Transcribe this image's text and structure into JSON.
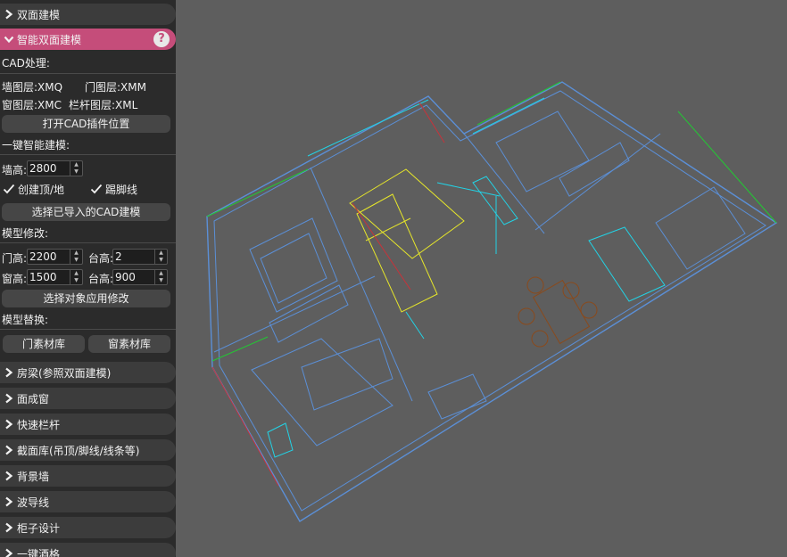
{
  "panel": {
    "sec_double_face": "双面建模",
    "sec_smart": "智能双面建模",
    "help_glyph": "?",
    "cad_process": "CAD处理:",
    "wall_layer": "墙图层:XMQ",
    "door_layer": "门图层:XMM",
    "window_layer": "窗图层:XMC",
    "rail_layer": "栏杆图层:XML",
    "open_cad_btn": "打开CAD插件位置",
    "one_click": "一键智能建模:",
    "wall_height_label": "墙高:",
    "wall_height": "2800",
    "create_top_bottom": "创建顶/地",
    "skirting": "踢脚线",
    "select_imported_btn": "选择已导入的CAD建模",
    "model_modify": "模型修改:",
    "door_height_label": "门高:",
    "door_height": "2200",
    "door_sill_label": "台高:",
    "door_sill": "2",
    "window_height_label": "窗高:",
    "window_height": "1500",
    "window_sill_label": "台高:",
    "window_sill": "900",
    "apply_modify_btn": "选择对象应用修改",
    "model_replace": "模型替换:",
    "door_lib_btn": "门素材库",
    "window_lib_btn": "窗素材库",
    "sec_beam": "房梁(参照双面建模)",
    "sec_face_window": "面成窗",
    "sec_rail": "快速栏杆",
    "sec_section_lib": "截面库(吊顶/脚线/线条等)",
    "sec_bg_wall": "背景墙",
    "sec_wave": "波导线",
    "sec_cabinet": "柜子设计",
    "sec_last": "一键酒格"
  },
  "colors": {
    "accent": "#c54d7a",
    "wall": "#5b8fd6",
    "cyan": "#22d3e6",
    "yellow": "#e6e62a",
    "green": "#22c933",
    "red": "#c8323a",
    "brown": "#8a4a1c"
  }
}
